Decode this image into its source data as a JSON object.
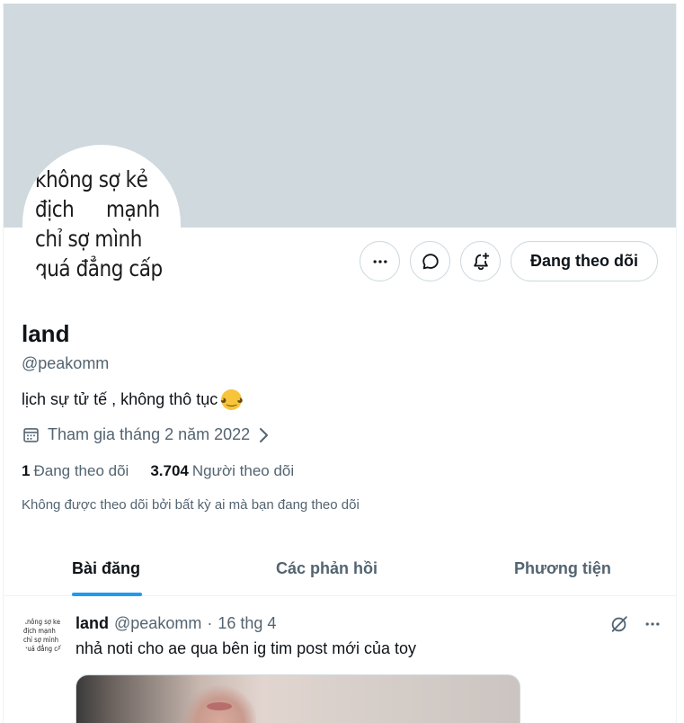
{
  "profile": {
    "name": "land",
    "handle": "@peakomm",
    "bio": "lịch sự tử tế , không thô tục",
    "bio_emoji": "😉",
    "joined": "Tham gia tháng 2 năm 2022",
    "following_count": "1",
    "following_label": "Đang theo dõi",
    "followers_count": "3.704",
    "followers_label": "Người theo dõi",
    "followed_by": "Không được theo dõi bởi bất kỳ ai mà bạn đang theo dõi",
    "avatar_lines": [
      "không sợ kẻ",
      "địch mạnh",
      "chỉ sợ mình",
      "quá đẳng cấp"
    ]
  },
  "actions": {
    "more_icon": "more-horizontal-icon",
    "message_icon": "message-bubble-icon",
    "notify_icon": "bell-plus-icon",
    "follow_label": "Đang theo dõi"
  },
  "tabs": [
    {
      "label": "Bài đăng",
      "active": true
    },
    {
      "label": "Các phản hồi",
      "active": false
    },
    {
      "label": "Phương tiện",
      "active": false
    }
  ],
  "post": {
    "name": "land",
    "handle": "@peakomm",
    "date": "16 thg 4",
    "separator": "·",
    "text": "nhả noti cho ae qua bên ig tim post mới của toy",
    "grok_icon": "grok-icon",
    "more_icon": "more-horizontal-icon"
  },
  "colors": {
    "banner": "#cfd9de",
    "accent": "#1d9bf0",
    "secondary_text": "#536471",
    "border": "#cfd9de"
  }
}
